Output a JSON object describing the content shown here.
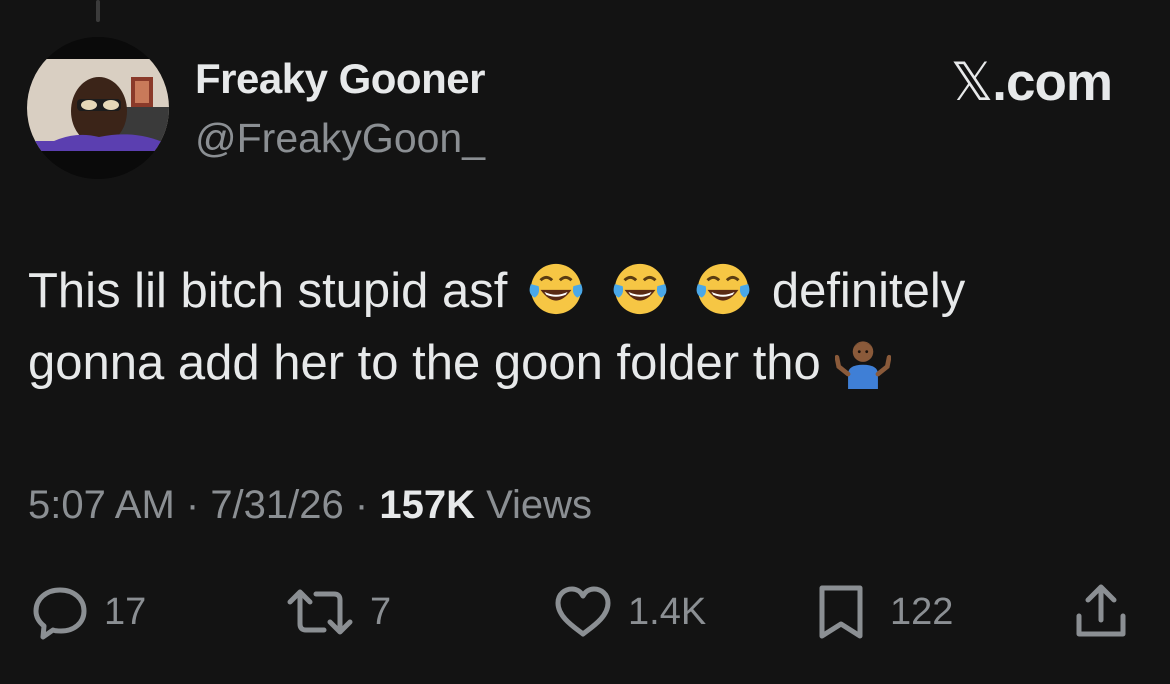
{
  "author": {
    "name": "Freaky Gooner",
    "handle": "@FreakyGoon_"
  },
  "brand": {
    "glyph": "𝕏",
    "suffix": ".com"
  },
  "tweet": {
    "line1_before": "This lil bitch stupid asf",
    "line1_after": "definitely",
    "line2": "gonna add her to the goon folder tho",
    "emojis": [
      "face-with-tears-of-joy",
      "face-with-tears-of-joy",
      "face-with-tears-of-joy",
      "person-shrugging"
    ]
  },
  "meta": {
    "time": "5:07 AM",
    "sep1": " · ",
    "date": "7/31/26",
    "sep2": " · ",
    "views_count": "157K",
    "views_label": " Views"
  },
  "actions": {
    "replies": "17",
    "reposts": "7",
    "likes": "1.4K",
    "bookmarks": "122"
  },
  "colors": {
    "background": "#131313",
    "text": "#e7e9ea",
    "secondary": "#8b8f93"
  }
}
